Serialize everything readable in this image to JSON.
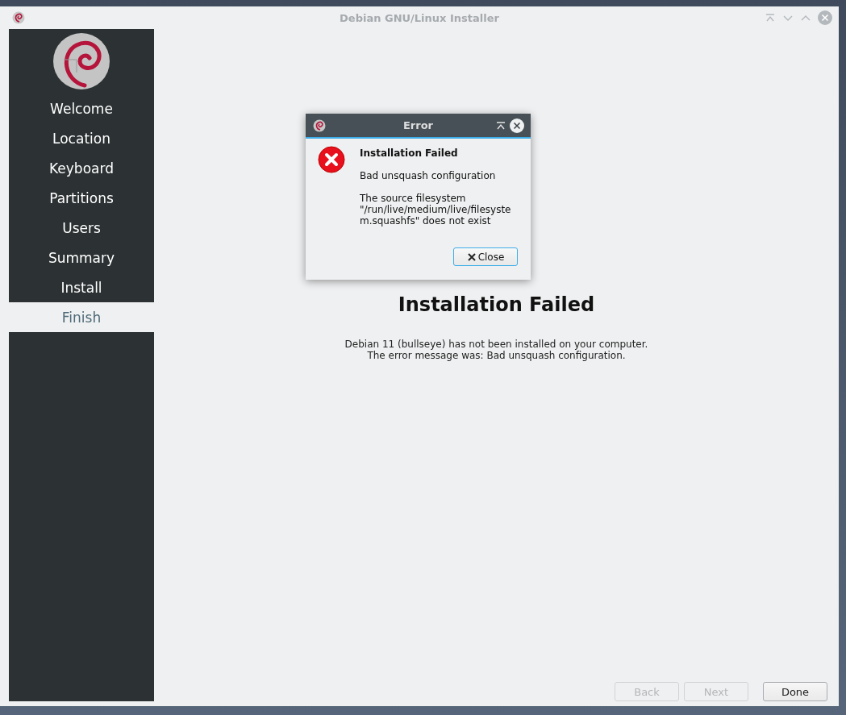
{
  "window": {
    "title": "Debian GNU/Linux Installer"
  },
  "sidebar": {
    "items": [
      {
        "label": "Welcome",
        "selected": false
      },
      {
        "label": "Location",
        "selected": false
      },
      {
        "label": "Keyboard",
        "selected": false
      },
      {
        "label": "Partitions",
        "selected": false
      },
      {
        "label": "Users",
        "selected": false
      },
      {
        "label": "Summary",
        "selected": false
      },
      {
        "label": "Install",
        "selected": false
      },
      {
        "label": "Finish",
        "selected": true
      }
    ]
  },
  "page": {
    "heading": "Installation Failed",
    "lines": [
      "Debian 11 (bullseye) has not been installed on your computer.",
      "The error message was: Bad unsquash configuration."
    ]
  },
  "buttons": [
    {
      "label": "Back",
      "disabled": true
    },
    {
      "label": "Next",
      "disabled": true
    },
    {
      "label": "Done",
      "disabled": false
    }
  ],
  "dialog": {
    "title": "Error",
    "heading": "Installation Failed",
    "summary": "Bad unsquash configuration",
    "details": "The source filesystem \"/run/live/medium/live/filesystem.squashfs\" does not exist",
    "button": "Close"
  }
}
